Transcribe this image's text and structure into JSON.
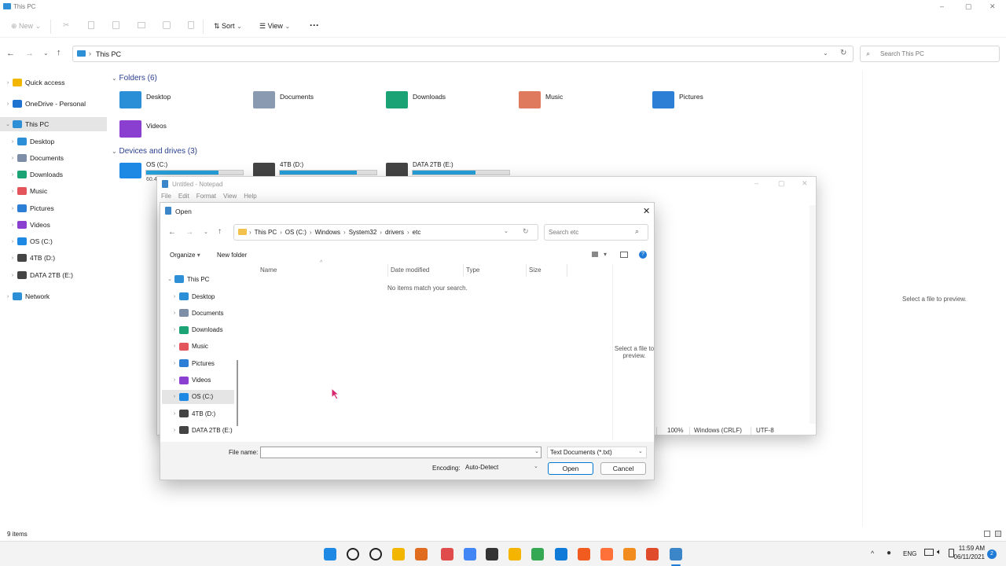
{
  "explorer": {
    "title": "This PC",
    "window_controls": {
      "minimize": "–",
      "maximize": "▢",
      "close": "✕"
    },
    "toolbar": {
      "new_label": "New",
      "sort_label": "Sort",
      "view_label": "View",
      "more_label": "···"
    },
    "address": {
      "location": "This PC",
      "search_placeholder": "Search This PC"
    },
    "nav": [
      {
        "label": "Quick access",
        "icon": "star-icon",
        "color": "#f2b600"
      },
      {
        "label": "OneDrive - Personal",
        "icon": "cloud-icon",
        "color": "#1e73d0"
      },
      {
        "label": "This PC",
        "icon": "computer-icon",
        "color": "#2d8fd6"
      },
      {
        "label": "Desktop",
        "icon": "desktop-icon",
        "color": "#2b8fd8"
      },
      {
        "label": "Documents",
        "icon": "documents-icon",
        "color": "#7e8ea6"
      },
      {
        "label": "Downloads",
        "icon": "downloads-icon",
        "color": "#1ba376"
      },
      {
        "label": "Music",
        "icon": "music-icon",
        "color": "#e3545b"
      },
      {
        "label": "Pictures",
        "icon": "pictures-icon",
        "color": "#2d7fd6"
      },
      {
        "label": "Videos",
        "icon": "videos-icon",
        "color": "#8a3fd1"
      },
      {
        "label": "OS (C:)",
        "icon": "windows-drive-icon",
        "color": "#1e88e5"
      },
      {
        "label": "4TB (D:)",
        "icon": "drive-icon",
        "color": "#444"
      },
      {
        "label": "DATA 2TB (E:)",
        "icon": "drive-icon",
        "color": "#444"
      },
      {
        "label": "Network",
        "icon": "network-icon",
        "color": "#2d8fd6"
      }
    ],
    "folders_header": "Folders (6)",
    "folders": [
      {
        "label": "Desktop",
        "color": "#2b8fd8"
      },
      {
        "label": "Documents",
        "color": "#8a9ab0"
      },
      {
        "label": "Downloads",
        "color": "#1ba376"
      },
      {
        "label": "Music",
        "color": "#e07a5f"
      },
      {
        "label": "Pictures",
        "color": "#2d7fd6"
      },
      {
        "label": "Videos",
        "color": "#8a3fd1"
      }
    ],
    "drives_header": "Devices and drives (3)",
    "drives": [
      {
        "label": "OS (C:)",
        "used": 0.75,
        "free_text": "60.4"
      },
      {
        "label": "4TB (D:)",
        "used": 0.8
      },
      {
        "label": "DATA 2TB (E:)",
        "used": 0.65
      }
    ],
    "preview_text": "Select a file to preview.",
    "status_items": "9 items"
  },
  "notepad": {
    "title": "Untitled - Notepad",
    "menu": [
      "File",
      "Edit",
      "Format",
      "View",
      "Help"
    ],
    "status": {
      "zoom": "100%",
      "eol": "Windows (CRLF)",
      "encoding": "UTF-8"
    }
  },
  "dialog": {
    "title": "Open",
    "breadcrumb": [
      "This PC",
      "OS (C:)",
      "Windows",
      "System32",
      "drivers",
      "etc"
    ],
    "search_placeholder": "Search etc",
    "organize_label": "Organize",
    "new_folder_label": "New folder",
    "tree": [
      {
        "label": "This PC",
        "color": "#2d8fd6"
      },
      {
        "label": "Desktop",
        "color": "#2b8fd8"
      },
      {
        "label": "Documents",
        "color": "#7e8ea6"
      },
      {
        "label": "Downloads",
        "color": "#1ba376"
      },
      {
        "label": "Music",
        "color": "#e3545b"
      },
      {
        "label": "Pictures",
        "color": "#2d7fd6"
      },
      {
        "label": "Videos",
        "color": "#8a3fd1"
      },
      {
        "label": "OS (C:)",
        "color": "#1e88e5"
      },
      {
        "label": "4TB (D:)",
        "color": "#444"
      },
      {
        "label": "DATA 2TB (E:)",
        "color": "#444"
      }
    ],
    "columns": [
      "Name",
      "Date modified",
      "Type",
      "Size"
    ],
    "empty_message": "No items match your search.",
    "preview_text": "Select a file to preview.",
    "file_name_label": "File name:",
    "file_name_value": "",
    "filter_value": "Text Documents (*.txt)",
    "encoding_label": "Encoding:",
    "encoding_value": "Auto-Detect",
    "open_label": "Open",
    "cancel_label": "Cancel"
  },
  "taskbar": {
    "language": "ENG",
    "time": "11:59 AM",
    "date": "06/11/2021",
    "notification_count": "2",
    "apps": [
      {
        "name": "start-icon",
        "color": "#1e88e5"
      },
      {
        "name": "search-icon",
        "color": "#222"
      },
      {
        "name": "task-view-icon",
        "color": "#222"
      },
      {
        "name": "file-explorer-icon",
        "color": "#f2b600"
      },
      {
        "name": "snipping-tool-icon",
        "color": "#e06c1f"
      },
      {
        "name": "chrome-badge-icon",
        "color": "#e04b4b"
      },
      {
        "name": "chrome-icon",
        "color": "#4285f4"
      },
      {
        "name": "terminal-icon",
        "color": "#333"
      },
      {
        "name": "chrome-canary-icon",
        "color": "#f4b400"
      },
      {
        "name": "chrome-dev-icon",
        "color": "#34a853"
      },
      {
        "name": "edge-icon",
        "color": "#0f7ad8"
      },
      {
        "name": "brave-icon",
        "color": "#f25b1f"
      },
      {
        "name": "firefox-icon",
        "color": "#ff7139"
      },
      {
        "name": "app-icon",
        "color": "#f28c1f"
      },
      {
        "name": "app-red-icon",
        "color": "#e04b2c"
      },
      {
        "name": "notepad-icon",
        "color": "#3a86c8"
      }
    ]
  }
}
